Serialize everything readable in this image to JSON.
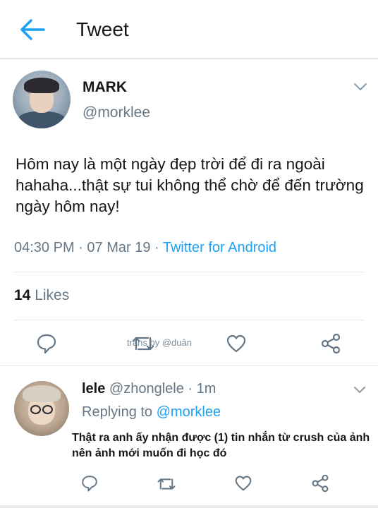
{
  "header": {
    "title": "Tweet"
  },
  "tweet": {
    "author_name": "MARK",
    "author_handle": "@morklee",
    "text": "Hôm nay là một ngày đẹp trời để đi ra ngoài hahaha...thật sự tui không thể chờ để đến trường ngày hôm nay!",
    "time": "04:30 PM",
    "date": "07 Mar 19",
    "separator": " · ",
    "source": "Twitter for Android",
    "likes_count": "14",
    "likes_label": "Likes"
  },
  "watermark": "trans by @duân",
  "reply": {
    "author_name": "lele",
    "author_handle": "@zhonglele",
    "time": "1m",
    "separator": " · ",
    "replying_label": "Replying to",
    "replying_to": "@morklee",
    "text": "Thật ra anh ấy nhận được (1) tin nhắn từ crush của ảnh nên ảnh mới muốn đi học đó"
  },
  "icons": {
    "back": "back-arrow-icon",
    "menu": "chevron-down-icon",
    "reply": "reply-bubble-icon",
    "retweet": "retweet-icon",
    "like": "heart-icon",
    "share": "share-icon"
  },
  "colors": {
    "accent": "#1da1f2",
    "secondary_text": "#657786",
    "primary_text": "#14171a"
  }
}
